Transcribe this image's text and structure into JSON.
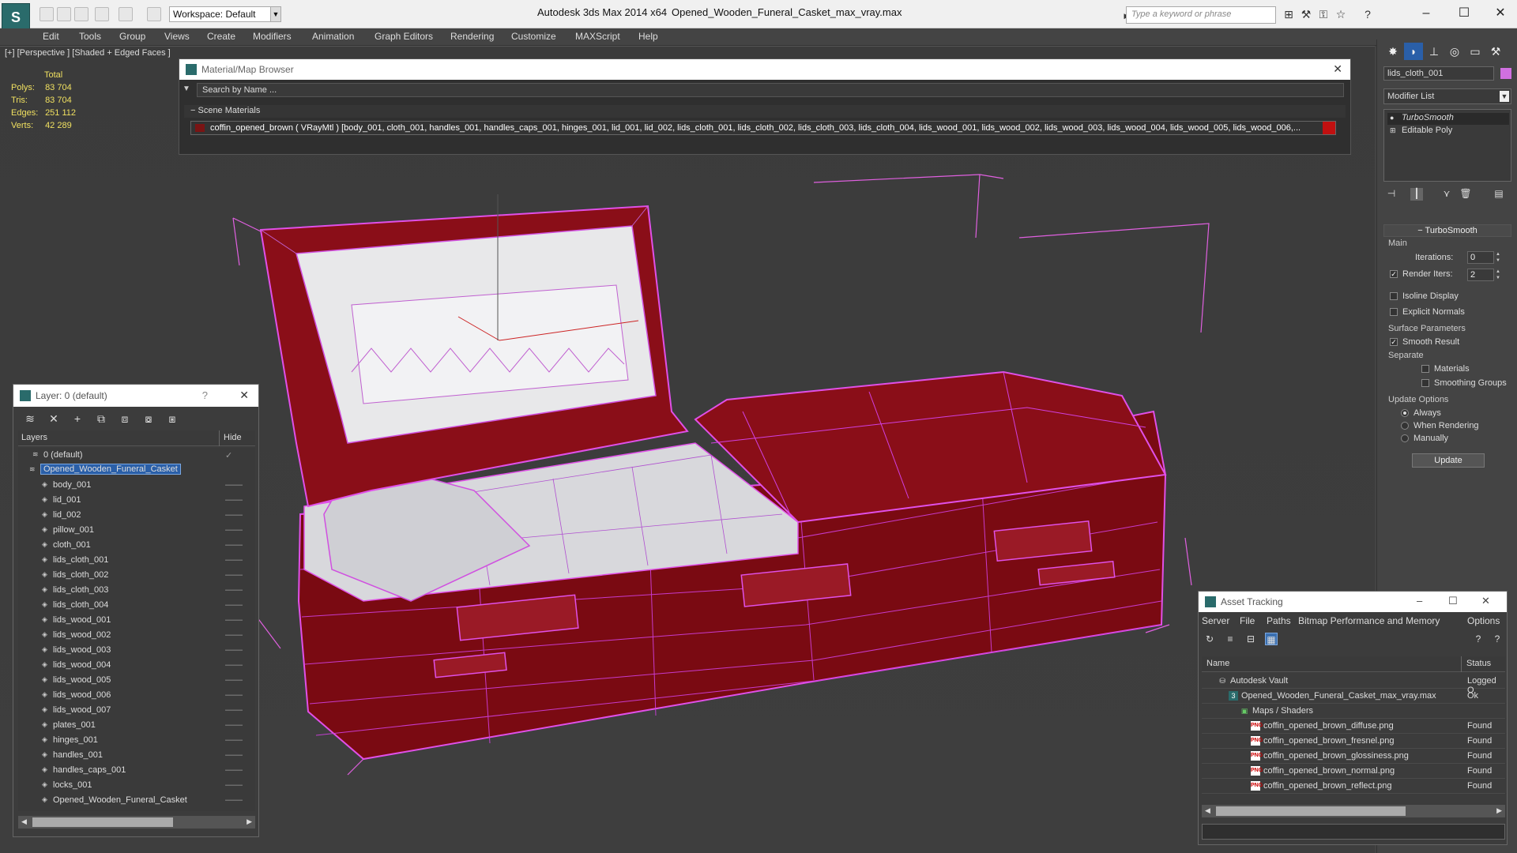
{
  "titlebar": {
    "workspace": "Workspace: Default",
    "app_title": "Autodesk 3ds Max  2014 x64",
    "file_title": "Opened_Wooden_Funeral_Casket_max_vray.max",
    "search_placeholder": "Type a keyword or phrase"
  },
  "menu": [
    "Edit",
    "Tools",
    "Group",
    "Views",
    "Create",
    "Modifiers",
    "Animation",
    "Graph Editors",
    "Rendering",
    "Customize",
    "MAXScript",
    "Help"
  ],
  "viewport": {
    "label": "[+] [Perspective ] [Shaded + Edged Faces ]",
    "stats_header": "Total",
    "stats": [
      {
        "label": "Polys:",
        "value": "83 704"
      },
      {
        "label": "Tris:",
        "value": "83 704"
      },
      {
        "label": "Edges:",
        "value": "251 112"
      },
      {
        "label": "Verts:",
        "value": "42 289"
      }
    ]
  },
  "material_browser": {
    "title": "Material/Map Browser",
    "search_placeholder": "Search by Name ...",
    "group": "Scene Materials",
    "row": "coffin_opened_brown ( VRayMtl ) [body_001, cloth_001, handles_001, handles_caps_001, hinges_001, lid_001, lid_002, lids_cloth_001, lids_cloth_002, lids_cloth_003, lids_cloth_004, lids_wood_001, lids_wood_002, lids_wood_003, lids_wood_004, lids_wood_005, lids_wood_006,..."
  },
  "layer_explorer": {
    "title": "Layer: 0 (default)",
    "col_layers": "Layers",
    "col_hide": "Hide",
    "rows": [
      {
        "name": "0 (default)",
        "indent": 0,
        "hide": "✓"
      },
      {
        "name": "Opened_Wooden_Funeral_Casket",
        "indent": 1,
        "hide": "",
        "selected": true
      },
      {
        "name": "body_001",
        "indent": 2,
        "hide": "——"
      },
      {
        "name": "lid_001",
        "indent": 2,
        "hide": "——"
      },
      {
        "name": "lid_002",
        "indent": 2,
        "hide": "——"
      },
      {
        "name": "pillow_001",
        "indent": 2,
        "hide": "——"
      },
      {
        "name": "cloth_001",
        "indent": 2,
        "hide": "——"
      },
      {
        "name": "lids_cloth_001",
        "indent": 2,
        "hide": "——"
      },
      {
        "name": "lids_cloth_002",
        "indent": 2,
        "hide": "——"
      },
      {
        "name": "lids_cloth_003",
        "indent": 2,
        "hide": "——"
      },
      {
        "name": "lids_cloth_004",
        "indent": 2,
        "hide": "——"
      },
      {
        "name": "lids_wood_001",
        "indent": 2,
        "hide": "——"
      },
      {
        "name": "lids_wood_002",
        "indent": 2,
        "hide": "——"
      },
      {
        "name": "lids_wood_003",
        "indent": 2,
        "hide": "——"
      },
      {
        "name": "lids_wood_004",
        "indent": 2,
        "hide": "——"
      },
      {
        "name": "lids_wood_005",
        "indent": 2,
        "hide": "——"
      },
      {
        "name": "lids_wood_006",
        "indent": 2,
        "hide": "——"
      },
      {
        "name": "lids_wood_007",
        "indent": 2,
        "hide": "——"
      },
      {
        "name": "plates_001",
        "indent": 2,
        "hide": "——"
      },
      {
        "name": "hinges_001",
        "indent": 2,
        "hide": "——"
      },
      {
        "name": "handles_001",
        "indent": 2,
        "hide": "——"
      },
      {
        "name": "handles_caps_001",
        "indent": 2,
        "hide": "——"
      },
      {
        "name": "locks_001",
        "indent": 2,
        "hide": "——"
      },
      {
        "name": "Opened_Wooden_Funeral_Casket",
        "indent": 2,
        "hide": "——"
      }
    ]
  },
  "command_panel": {
    "object_name": "lids_cloth_001",
    "modifier_list": "Modifier List",
    "stack": [
      "TurboSmooth",
      "Editable Poly"
    ],
    "turbosmooth": {
      "title": "TurboSmooth",
      "main": "Main",
      "iterations_label": "Iterations:",
      "iterations": "0",
      "render_iters_label": "Render Iters:",
      "render_iters": "2",
      "isoline": "Isoline Display",
      "explicit": "Explicit Normals",
      "surface": "Surface Parameters",
      "smooth_result": "Smooth Result",
      "separate": "Separate",
      "materials": "Materials",
      "smoothing_groups": "Smoothing Groups",
      "update_options": "Update Options",
      "always": "Always",
      "when_rendering": "When Rendering",
      "manually": "Manually",
      "update": "Update"
    }
  },
  "asset_tracking": {
    "title": "Asset Tracking",
    "menu": [
      "Server",
      "File",
      "Paths",
      "Bitmap Performance and Memory",
      "Options"
    ],
    "col_name": "Name",
    "col_status": "Status",
    "rows": [
      {
        "name": "Autodesk Vault",
        "status": "Logged O",
        "indent": 0,
        "icon": "vault"
      },
      {
        "name": "Opened_Wooden_Funeral_Casket_max_vray.max",
        "status": "Ok",
        "indent": 1,
        "icon": "max"
      },
      {
        "name": "Maps / Shaders",
        "status": "",
        "indent": 2,
        "icon": "maps"
      },
      {
        "name": "coffin_opened_brown_diffuse.png",
        "status": "Found",
        "indent": 3,
        "icon": "png"
      },
      {
        "name": "coffin_opened_brown_fresnel.png",
        "status": "Found",
        "indent": 3,
        "icon": "png"
      },
      {
        "name": "coffin_opened_brown_glossiness.png",
        "status": "Found",
        "indent": 3,
        "icon": "png"
      },
      {
        "name": "coffin_opened_brown_normal.png",
        "status": "Found",
        "indent": 3,
        "icon": "png"
      },
      {
        "name": "coffin_opened_brown_reflect.png",
        "status": "Found",
        "indent": 3,
        "icon": "png"
      }
    ]
  }
}
